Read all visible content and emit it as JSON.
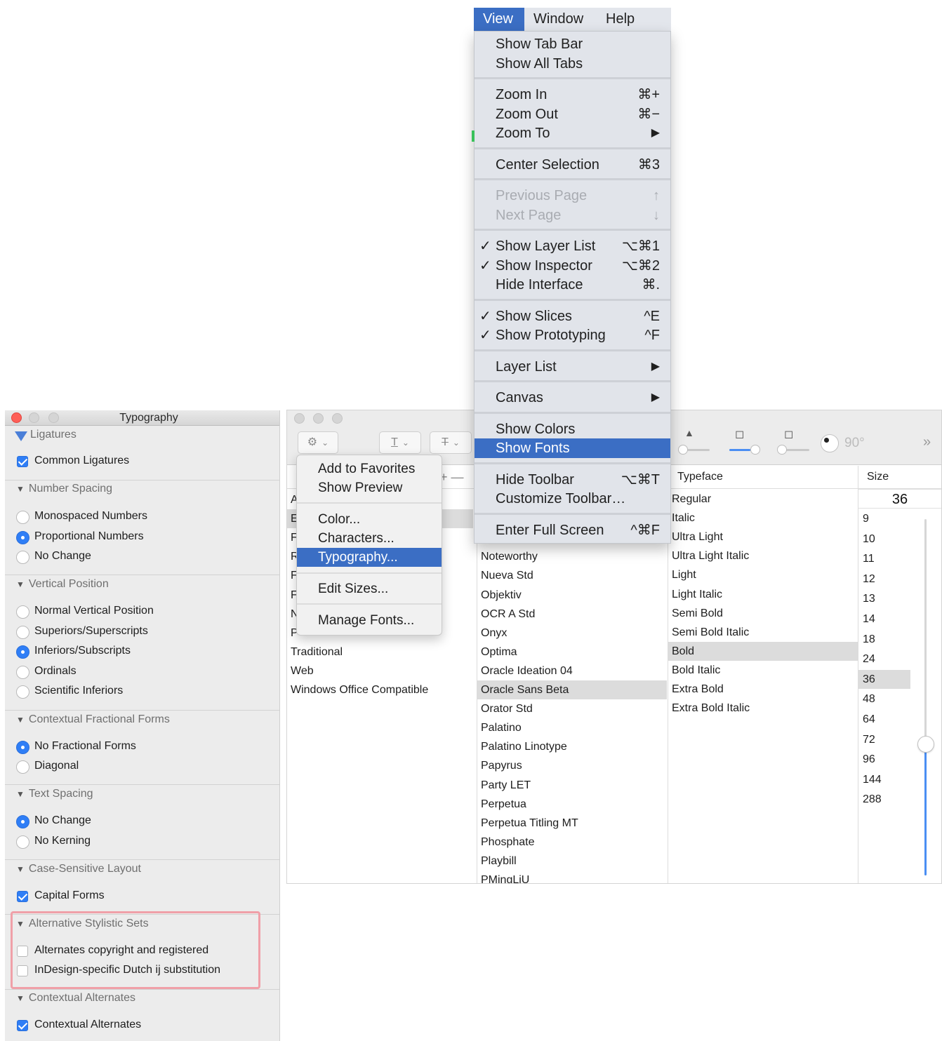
{
  "menubar": {
    "items": [
      {
        "label": "View",
        "active": true
      },
      {
        "label": "Window",
        "active": false
      },
      {
        "label": "Help",
        "active": false
      }
    ]
  },
  "view_menu": {
    "groups": [
      [
        {
          "label": "Show Tab Bar",
          "shortcut": "",
          "checked": false,
          "disabled": false
        },
        {
          "label": "Show All Tabs",
          "shortcut": "",
          "checked": false,
          "disabled": false
        }
      ],
      [
        {
          "label": "Zoom In",
          "shortcut": "⌘+",
          "checked": false,
          "disabled": false
        },
        {
          "label": "Zoom Out",
          "shortcut": "⌘−",
          "checked": false,
          "disabled": false
        },
        {
          "label": "Zoom To",
          "shortcut": "▶",
          "checked": false,
          "disabled": false
        }
      ],
      [
        {
          "label": "Center Selection",
          "shortcut": "⌘3",
          "checked": false,
          "disabled": false
        }
      ],
      [
        {
          "label": "Previous Page",
          "shortcut": "↑",
          "checked": false,
          "disabled": true
        },
        {
          "label": "Next Page",
          "shortcut": "↓",
          "checked": false,
          "disabled": true
        }
      ],
      [
        {
          "label": "Show Layer List",
          "shortcut": "⌥⌘1",
          "checked": true,
          "disabled": false
        },
        {
          "label": "Show Inspector",
          "shortcut": "⌥⌘2",
          "checked": true,
          "disabled": false
        },
        {
          "label": "Hide Interface",
          "shortcut": "⌘.",
          "checked": false,
          "disabled": false
        }
      ],
      [
        {
          "label": "Show Slices",
          "shortcut": "^E",
          "checked": true,
          "disabled": false
        },
        {
          "label": "Show Prototyping",
          "shortcut": "^F",
          "checked": true,
          "disabled": false
        }
      ],
      [
        {
          "label": "Layer List",
          "shortcut": "▶",
          "checked": false,
          "disabled": false
        }
      ],
      [
        {
          "label": "Canvas",
          "shortcut": "▶",
          "checked": false,
          "disabled": false
        }
      ],
      [
        {
          "label": "Show Colors",
          "shortcut": "",
          "checked": false,
          "disabled": false
        },
        {
          "label": "Show Fonts",
          "shortcut": "",
          "checked": false,
          "disabled": false,
          "selected": true
        }
      ],
      [
        {
          "label": "Hide Toolbar",
          "shortcut": "⌥⌘T",
          "checked": false,
          "disabled": false
        },
        {
          "label": "Customize Toolbar…",
          "shortcut": "",
          "checked": false,
          "disabled": false
        }
      ],
      [
        {
          "label": "Enter Full Screen",
          "shortcut": "^⌘F",
          "checked": false,
          "disabled": false
        }
      ]
    ],
    "checkmark": "✓"
  },
  "typography": {
    "title": "Typography",
    "sections": [
      {
        "title": "Ligatures",
        "control": "check",
        "options": [
          {
            "label": "Common Ligatures",
            "on": true
          }
        ]
      },
      {
        "title": "Number Spacing",
        "control": "radio",
        "options": [
          {
            "label": "Monospaced Numbers",
            "on": false
          },
          {
            "label": "Proportional Numbers",
            "on": true
          },
          {
            "label": "No Change",
            "on": false
          }
        ]
      },
      {
        "title": "Vertical Position",
        "control": "radio",
        "options": [
          {
            "label": "Normal Vertical Position",
            "on": false
          },
          {
            "label": "Superiors/Superscripts",
            "on": false
          },
          {
            "label": "Inferiors/Subscripts",
            "on": true
          },
          {
            "label": "Ordinals",
            "on": false
          },
          {
            "label": "Scientific Inferiors",
            "on": false
          }
        ]
      },
      {
        "title": "Contextual Fractional Forms",
        "control": "radio",
        "options": [
          {
            "label": "No Fractional Forms",
            "on": true
          },
          {
            "label": "Diagonal",
            "on": false
          }
        ]
      },
      {
        "title": "Text Spacing",
        "control": "radio",
        "options": [
          {
            "label": "No Change",
            "on": true
          },
          {
            "label": "No Kerning",
            "on": false
          }
        ]
      },
      {
        "title": "Case-Sensitive Layout",
        "control": "check",
        "options": [
          {
            "label": "Capital Forms",
            "on": true
          }
        ]
      },
      {
        "title": "Alternative Stylistic Sets",
        "control": "check",
        "options": [
          {
            "label": "Alternates copyright and registered",
            "on": false
          },
          {
            "label": "InDesign-specific Dutch ij substitution",
            "on": false
          }
        ]
      },
      {
        "title": "Contextual Alternates",
        "control": "check",
        "options": [
          {
            "label": "Contextual Alternates",
            "on": true
          }
        ]
      }
    ],
    "highlight_color": "#f0a0a8"
  },
  "gear_menu": {
    "groups": [
      [
        "Add to Favorites",
        "Show Preview"
      ],
      [
        "Color...",
        "Characters...",
        "Typography..."
      ],
      [
        "Edit Sizes..."
      ],
      [
        "Manage Fonts..."
      ]
    ],
    "selected": "Typography..."
  },
  "fonts_window": {
    "toolbar": {
      "degree_label": "90°",
      "more": "»"
    },
    "add_remove": "+  —",
    "collections": {
      "partial_letters": [
        "A",
        "E",
        "F",
        "R",
        "F",
        "F",
        "N",
        "P"
      ],
      "items": [
        "Traditional",
        "Web",
        "Windows Office Compatible"
      ]
    },
    "families": {
      "items": [
        "Noteworthy",
        "Nueva Std",
        "Objektiv",
        "OCR A Std",
        "Onyx",
        "Optima",
        "Oracle Ideation 04",
        "Oracle Sans Beta",
        "Orator Std",
        "Palatino",
        "Palatino Linotype",
        "Papyrus",
        "Party LET",
        "Perpetua",
        "Perpetua Titling MT",
        "Phosphate",
        "Playbill",
        "PMingLiU"
      ],
      "selected": "Oracle Sans Beta"
    },
    "typefaces": {
      "header": "Typeface",
      "items": [
        "Regular",
        "Italic",
        "Ultra Light",
        "Ultra Light Italic",
        "Light",
        "Light Italic",
        "Semi Bold",
        "Semi Bold Italic",
        "Bold",
        "Bold Italic",
        "Extra Bold",
        "Extra Bold Italic"
      ],
      "selected": "Bold"
    },
    "sizes": {
      "header": "Size",
      "value": "36",
      "items": [
        "9",
        "10",
        "11",
        "12",
        "13",
        "14",
        "18",
        "24",
        "36",
        "48",
        "64",
        "72",
        "96",
        "144",
        "288"
      ],
      "selected": "36"
    }
  },
  "colors": {
    "menu_highlight": "#3b6ec4",
    "accent_blue": "#2f7ef6",
    "panel_bg": "#ececec"
  }
}
